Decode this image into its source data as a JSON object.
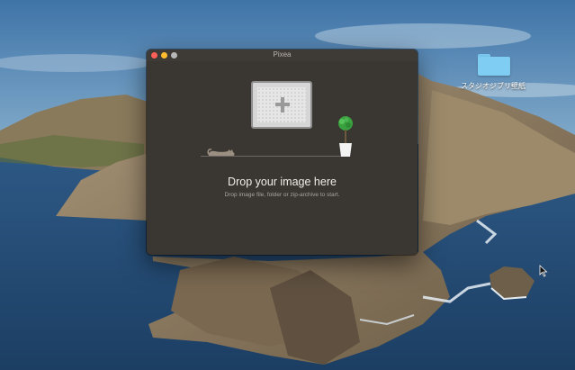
{
  "desktop": {
    "folder_label": "スタジオジブリ壁紙"
  },
  "window": {
    "title": "Pixea",
    "drop_title": "Drop your image here",
    "drop_subtitle": "Drop image file, folder or zip-archive to start."
  },
  "colors": {
    "window_bg": "#3a3632",
    "close": "#fe5f57",
    "minimize": "#febc2e",
    "zoom": "#b8b8b8",
    "plant_leaves": "#3aa13f"
  },
  "icons": [
    "plus-icon",
    "cat-icon",
    "plant-icon",
    "folder-icon",
    "cursor-icon"
  ]
}
